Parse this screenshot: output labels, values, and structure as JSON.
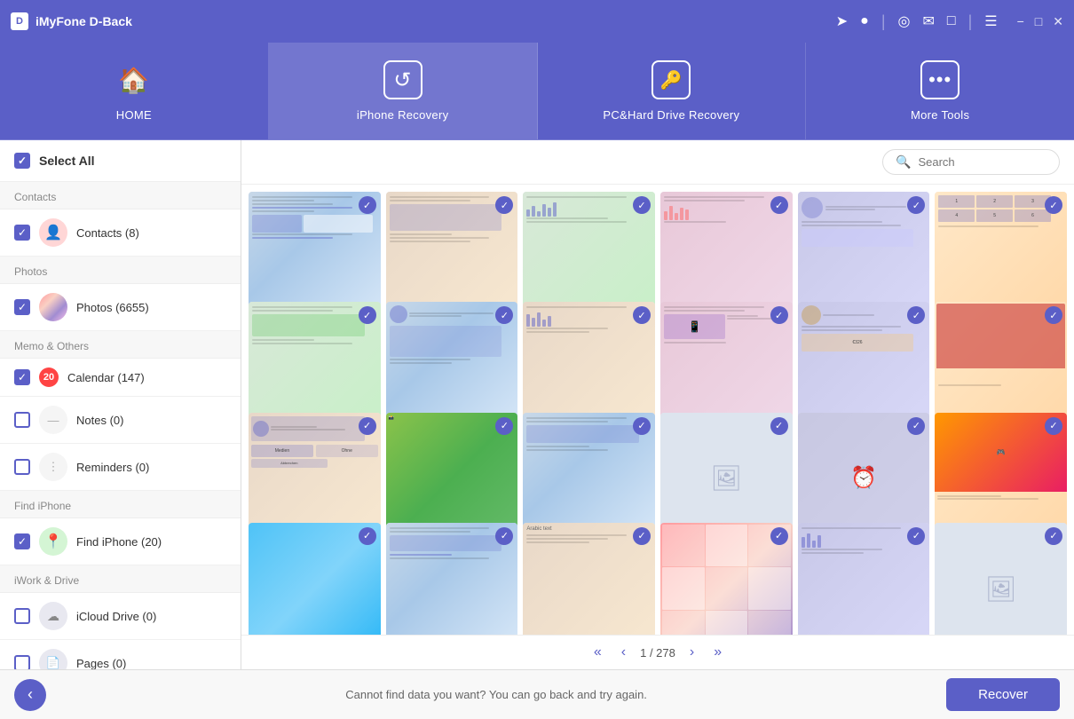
{
  "app": {
    "name": "iMyFone D-Back",
    "logo": "D"
  },
  "title_bar": {
    "icons": [
      "share-icon",
      "account-icon",
      "separator",
      "location-icon",
      "mail-icon",
      "chat-icon",
      "separator",
      "menu-icon",
      "minimize-icon",
      "maximize-icon",
      "close-icon"
    ]
  },
  "nav": {
    "items": [
      {
        "id": "home",
        "label": "HOME",
        "icon": "🏠"
      },
      {
        "id": "iphone-recovery",
        "label": "iPhone Recovery",
        "icon": "↺",
        "active": true
      },
      {
        "id": "pc-recovery",
        "label": "PC&Hard Drive Recovery",
        "icon": "🔑"
      },
      {
        "id": "more-tools",
        "label": "More Tools",
        "icon": "···"
      }
    ]
  },
  "sidebar": {
    "select_all_label": "Select All",
    "sections": [
      {
        "id": "contacts",
        "label": "Contacts",
        "items": [
          {
            "id": "contacts",
            "label": "Contacts (8)",
            "checked": true,
            "icon": "👤",
            "icon_class": "icon-contacts"
          }
        ]
      },
      {
        "id": "photos",
        "label": "Photos",
        "items": [
          {
            "id": "photos",
            "label": "Photos (6655)",
            "checked": true,
            "icon": "🌈",
            "icon_class": "icon-photos"
          }
        ]
      },
      {
        "id": "memo-others",
        "label": "Memo & Others",
        "items": [
          {
            "id": "calendar",
            "label": "Calendar (147)",
            "checked": true,
            "has_badge": true,
            "badge": "20",
            "icon": "📅",
            "icon_class": "icon-calendar"
          },
          {
            "id": "notes",
            "label": "Notes (0)",
            "checked": false,
            "icon": "📝",
            "icon_class": "icon-notes"
          },
          {
            "id": "reminders",
            "label": "Reminders (0)",
            "checked": false,
            "icon": "⋮",
            "icon_class": "icon-reminders"
          }
        ]
      },
      {
        "id": "find-iphone",
        "label": "Find iPhone",
        "items": [
          {
            "id": "find-iphone",
            "label": "Find iPhone (20)",
            "checked": true,
            "icon": "📍",
            "icon_class": "icon-findiphone"
          }
        ]
      },
      {
        "id": "iwork-drive",
        "label": "iWork & Drive",
        "items": [
          {
            "id": "icloud-drive",
            "label": "iCloud Drive (0)",
            "checked": false,
            "icon": "☁",
            "icon_class": "icon-icloud"
          },
          {
            "id": "pages",
            "label": "Pages (0)",
            "checked": false,
            "icon": "📄",
            "icon_class": "icon-pages"
          }
        ]
      }
    ]
  },
  "content": {
    "search_placeholder": "Search",
    "grid_rows": 3,
    "grid_cols": 6,
    "pagination": {
      "current": 1,
      "total": 278,
      "display": "1 / 278"
    },
    "thumbnails": [
      {
        "type": "type1",
        "checked": true
      },
      {
        "type": "type2",
        "checked": true
      },
      {
        "type": "type3",
        "checked": true
      },
      {
        "type": "type4",
        "checked": true
      },
      {
        "type": "type5",
        "checked": true
      },
      {
        "type": "type6",
        "checked": true
      },
      {
        "type": "type3",
        "checked": true
      },
      {
        "type": "type1",
        "checked": true
      },
      {
        "type": "type2",
        "checked": true
      },
      {
        "type": "type4",
        "checked": true
      },
      {
        "type": "type5",
        "checked": true
      },
      {
        "type": "type6",
        "checked": true
      },
      {
        "type": "type2",
        "checked": true
      },
      {
        "type": "type3",
        "checked": true
      },
      {
        "type": "type1",
        "checked": true
      },
      {
        "type": "empty",
        "checked": true
      },
      {
        "type": "type5",
        "checked": true
      },
      {
        "type": "type6",
        "checked": true
      },
      {
        "type": "type4",
        "checked": true
      },
      {
        "type": "type1",
        "checked": true
      },
      {
        "type": "type3",
        "checked": true
      },
      {
        "type": "type2",
        "checked": true
      },
      {
        "type": "type5",
        "checked": true
      },
      {
        "type": "empty",
        "checked": true
      }
    ]
  },
  "bottom": {
    "message": "Cannot find data you want? You can go back and try again.",
    "recover_label": "Recover",
    "back_icon": "‹"
  }
}
